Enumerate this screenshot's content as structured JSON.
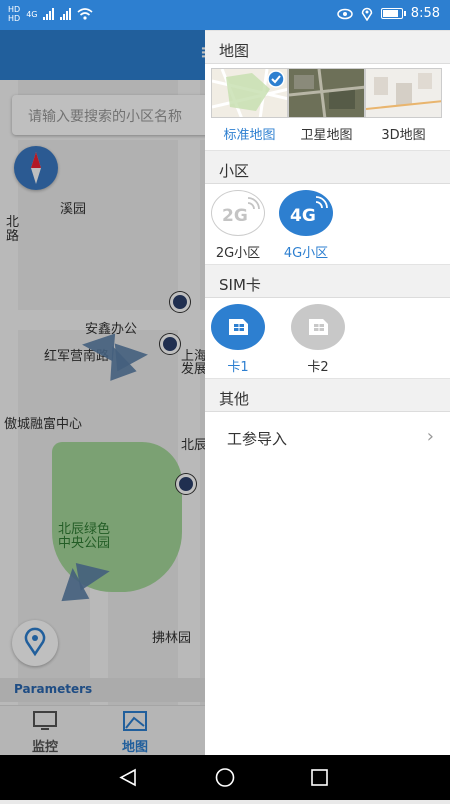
{
  "status": {
    "time": "8:58",
    "sim1": "HD",
    "sim2": "HD",
    "net": "4G"
  },
  "background": {
    "search_placeholder": "请输入要搜索的小区名称",
    "map_labels": {
      "park_name": "北辰绿色中央公园",
      "park_line1": "北辰绿色",
      "park_line2": "中央公园",
      "office": "安鑫办公",
      "road": "红军营南路",
      "center": "傲城融富中心",
      "garden": "溪园",
      "fulin": "拂林园",
      "shanghai": "上海",
      "fazhan": "发展",
      "beichen": "北辰",
      "bei": "北",
      "lu": "路"
    },
    "parameters_label": "Parameters",
    "nav": [
      {
        "label": "监控",
        "icon": "monitor-icon"
      },
      {
        "label": "地图",
        "icon": "map-icon"
      }
    ]
  },
  "drawer": {
    "map_section": {
      "title": "地图",
      "options": [
        {
          "label": "标准地图",
          "selected": true
        },
        {
          "label": "卫星地图",
          "selected": false
        },
        {
          "label": "3D地图",
          "selected": false
        }
      ]
    },
    "cell_section": {
      "title": "小区",
      "options": [
        {
          "label": "2G小区",
          "badge": "2G",
          "selected": false
        },
        {
          "label": "4G小区",
          "badge": "4G",
          "selected": true
        }
      ]
    },
    "sim_section": {
      "title": "SIM卡",
      "options": [
        {
          "label": "卡1",
          "selected": true
        },
        {
          "label": "卡2",
          "selected": false
        }
      ]
    },
    "other_section": {
      "title": "其他",
      "items": [
        {
          "label": "工参导入"
        }
      ]
    }
  },
  "colors": {
    "accent": "#2d7fd0",
    "inactive": "#c8c8c8"
  }
}
